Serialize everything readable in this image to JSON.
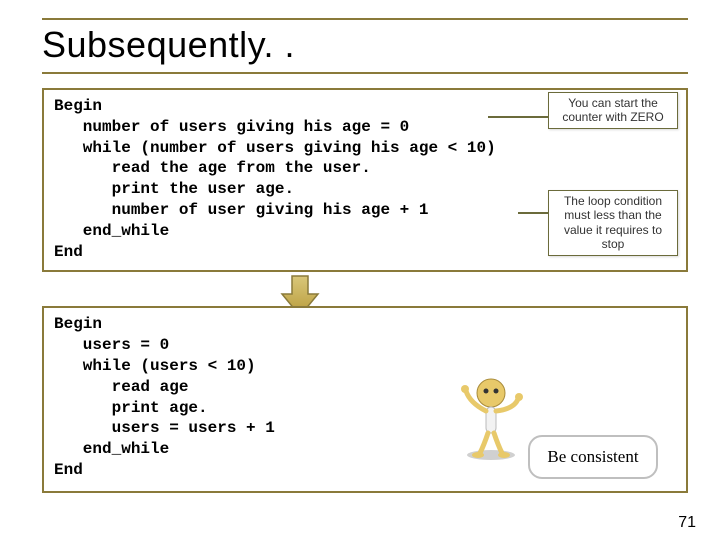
{
  "title": "Subsequently. .",
  "codebox1": {
    "lines": [
      "Begin",
      "   number of users giving his age = 0",
      "   while (number of users giving his age < 10)",
      "      read the age from the user.",
      "      print the user age.",
      "      number of user giving his age + 1",
      "   end_while",
      "End"
    ],
    "callout1": "You can start the counter with ZERO",
    "callout2": "The loop condition must less than the value it requires to stop"
  },
  "codebox2": {
    "lines": [
      "Begin",
      "   users = 0",
      "   while (users < 10)",
      "      read age",
      "      print age.",
      "      users = users + 1",
      "   end_while",
      "End"
    ],
    "speech": "Be consistent"
  },
  "page_number": "71"
}
